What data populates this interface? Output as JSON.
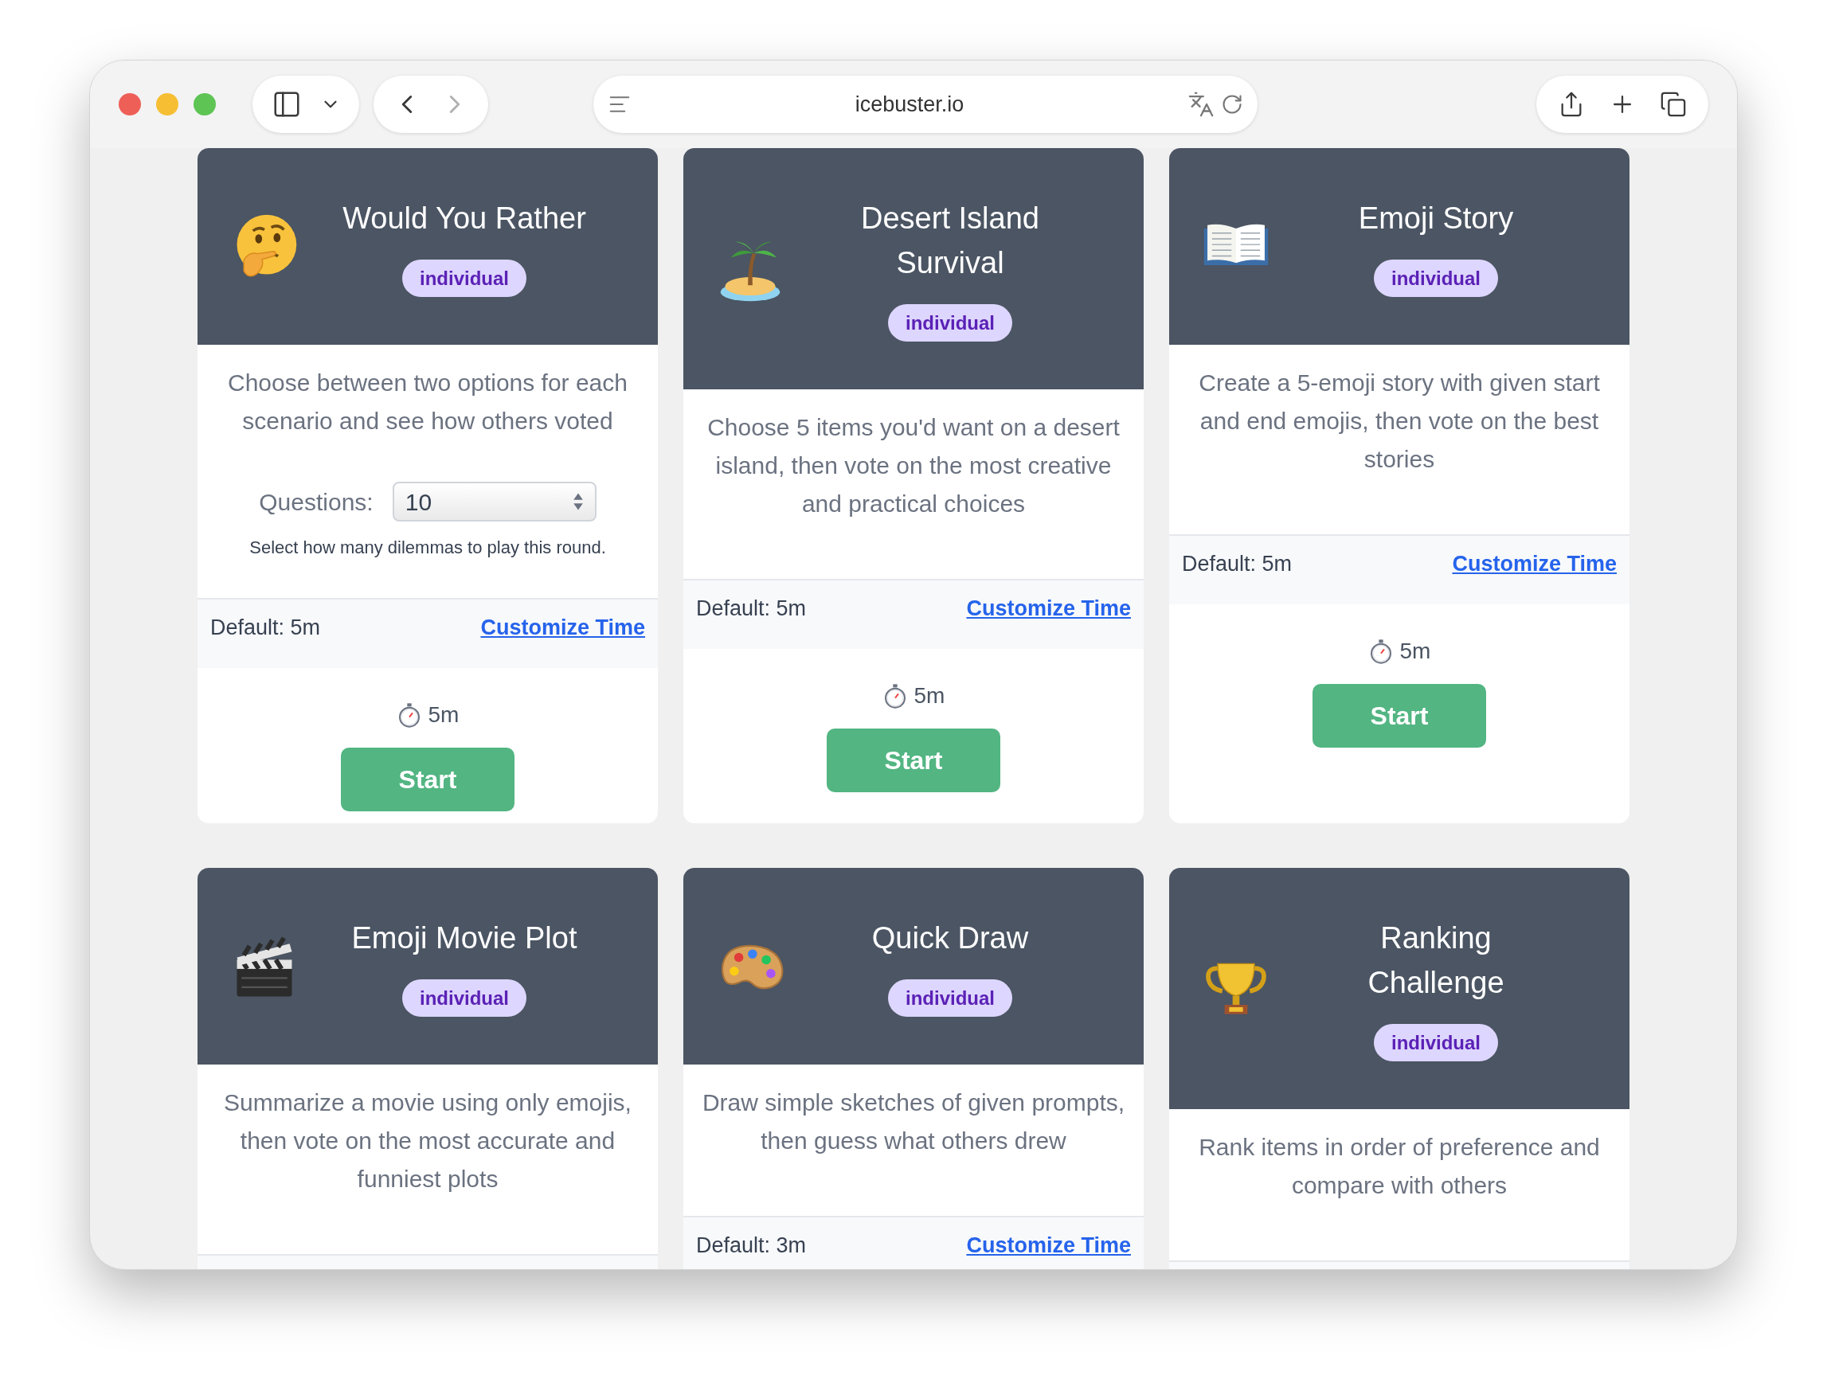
{
  "browser": {
    "url": "icebuster.io"
  },
  "cards": [
    {
      "title": "Would You Rather",
      "badge": "individual",
      "description": "Choose between two options for each scenario and see how others voted",
      "questions": {
        "label": "Questions:",
        "value": "10",
        "hint": "Select how many dilemmas to play this round."
      },
      "default_time": "Default: 5m",
      "customize_link": "Customize Time",
      "timer": "5m",
      "start_button": "Start"
    },
    {
      "title": "Desert Island Survival",
      "badge": "individual",
      "description": "Choose 5 items you'd want on a desert island, then vote on the most creative and practical choices",
      "default_time": "Default: 5m",
      "customize_link": "Customize Time",
      "timer": "5m",
      "start_button": "Start"
    },
    {
      "title": "Emoji Story",
      "badge": "individual",
      "description": "Create a 5-emoji story with given start and end emojis, then vote on the best stories",
      "default_time": "Default: 5m",
      "customize_link": "Customize Time",
      "timer": "5m",
      "start_button": "Start"
    },
    {
      "title": "Emoji Movie Plot",
      "badge": "individual",
      "description": "Summarize a movie using only emojis, then vote on the most accurate and funniest plots"
    },
    {
      "title": "Quick Draw",
      "badge": "individual",
      "description": "Draw simple sketches of given prompts, then guess what others drew",
      "default_time": "Default: 3m",
      "customize_link": "Customize Time"
    },
    {
      "title": "Ranking Challenge",
      "badge": "individual",
      "description": "Rank items in order of preference and compare with others"
    }
  ]
}
